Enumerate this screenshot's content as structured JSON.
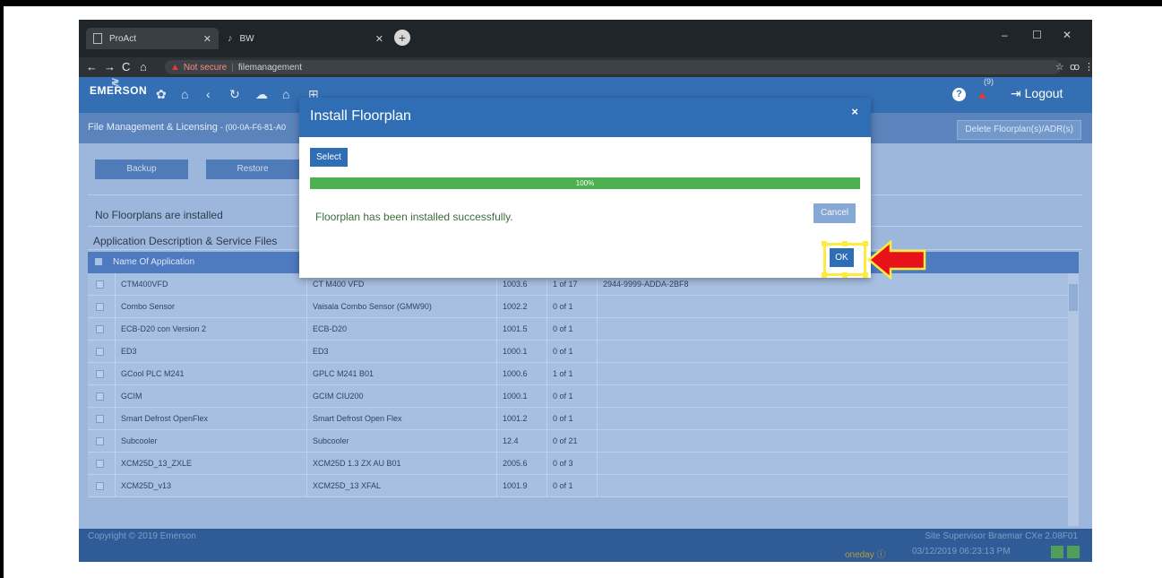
{
  "browser": {
    "tabs": [
      {
        "label": "ProAct",
        "icon": "page-icon"
      },
      {
        "label": "BW",
        "icon": "emerson-icon"
      }
    ],
    "url_warning": "Not secure",
    "url": "filemanagement"
  },
  "header": {
    "logo": "EMERSON",
    "alarm_count": "(9)",
    "logout_label": "Logout",
    "icons": [
      "gear-icon",
      "home-icon",
      "back-icon",
      "refresh-icon",
      "cloud-icon",
      "store-icon",
      "store-alt-icon",
      "help-icon",
      "alarm-icon"
    ]
  },
  "subheader": {
    "title": "File Management & Licensing",
    "device_id": "- (00-0A-F6-81-A0",
    "delete_label": "Delete Floorplan(s)/ADR(s)"
  },
  "actions": {
    "backup_label": "Backup",
    "restore_label": "Restore"
  },
  "status": {
    "no_floorplans": "No Floorplans are installed",
    "app_desc": "Application Description & Service Files"
  },
  "table": {
    "header": "Name Of Application",
    "rows": [
      {
        "name": "CTM400VFD",
        "desc": "CT M400 VFD",
        "version": "1003.6",
        "count": "1 of 17",
        "extra": "2944-9999-ADDA-2BF8"
      },
      {
        "name": "Combo Sensor",
        "desc": "Vaisala Combo Sensor (GMW90)",
        "version": "1002.2",
        "count": "0 of 1",
        "extra": ""
      },
      {
        "name": "ECB-D20 con Version 2",
        "desc": "ECB-D20",
        "version": "1001.5",
        "count": "0 of 1",
        "extra": ""
      },
      {
        "name": "ED3",
        "desc": "ED3",
        "version": "1000.1",
        "count": "0 of 1",
        "extra": ""
      },
      {
        "name": "GCool PLC M241",
        "desc": "GPLC M241 B01",
        "version": "1000.6",
        "count": "1 of 1",
        "extra": ""
      },
      {
        "name": "GCIM",
        "desc": "GCIM CIU200",
        "version": "1000.1",
        "count": "0 of 1",
        "extra": ""
      },
      {
        "name": "Smart Defrost OpenFlex",
        "desc": "Smart Defrost Open Flex",
        "version": "1001.2",
        "count": "0 of 1",
        "extra": ""
      },
      {
        "name": "Subcooler",
        "desc": "Subcooler",
        "version": "12.4",
        "count": "0 of 21",
        "extra": ""
      },
      {
        "name": "XCM25D_13_ZXLE",
        "desc": "XCM25D 1.3 ZX AU B01",
        "version": "2005.6",
        "count": "0 of 3",
        "extra": ""
      },
      {
        "name": "XCM25D_v13",
        "desc": "XCM25D_13 XFAL",
        "version": "1001.9",
        "count": "0 of 1",
        "extra": ""
      }
    ]
  },
  "footer": {
    "copyright": "Copyright © 2019 Emerson",
    "version": "Site Supervisor Braemar CXe 2.08F01",
    "oneday": "oneday",
    "datetime": "03/12/2019 06:23:13 PM"
  },
  "modal": {
    "title": "Install Floorplan",
    "close": "×",
    "select_label": "Select",
    "progress_text": "100%",
    "progress_fraction": 1.0,
    "message": "Floorplan has been installed successfully.",
    "cancel_label": "Cancel",
    "ok_label": "OK"
  },
  "colors": {
    "accent": "#2f6eb5",
    "progress": "#4caf50",
    "highlight": "#ffeb3b",
    "arrow": "#e8121a"
  }
}
